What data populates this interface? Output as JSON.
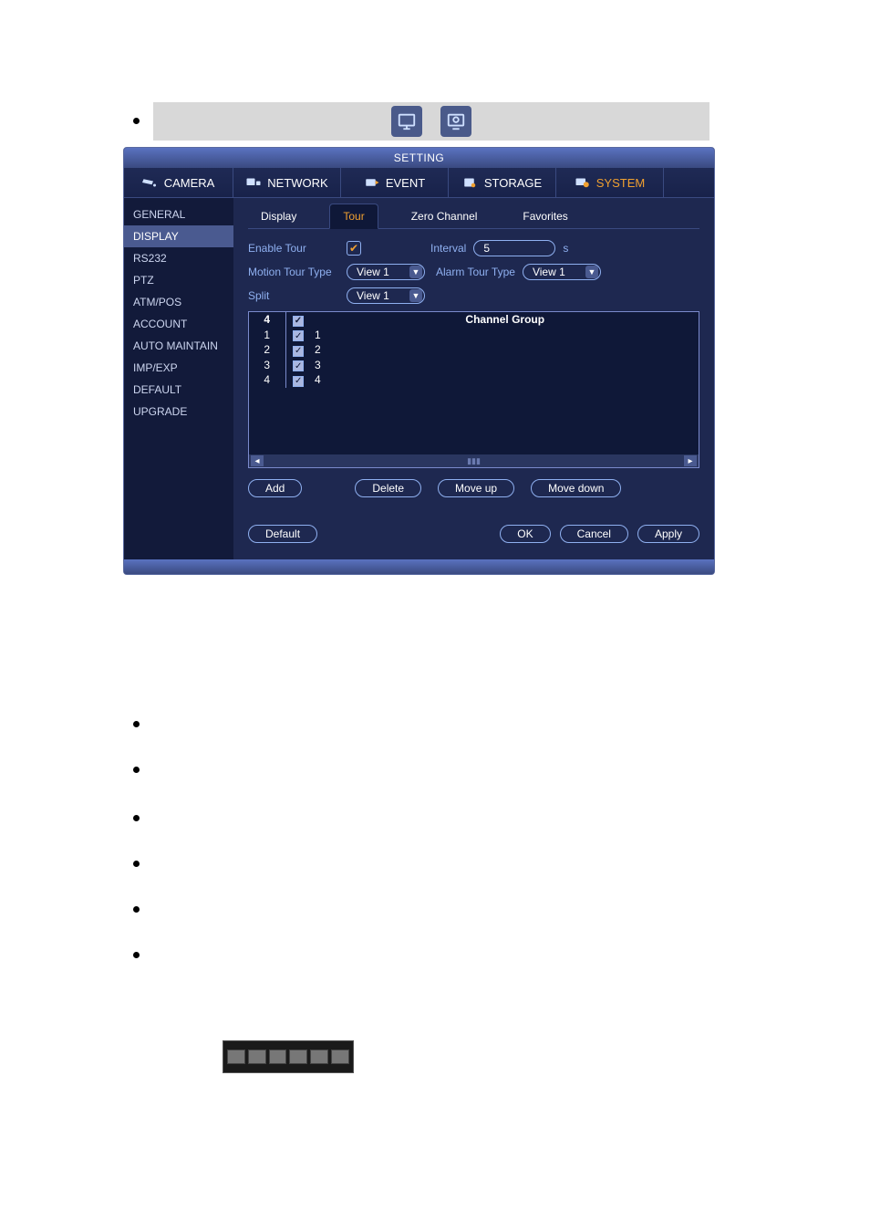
{
  "dialog_title": "SETTING",
  "toptabs": [
    {
      "label": "CAMERA"
    },
    {
      "label": "NETWORK"
    },
    {
      "label": "EVENT"
    },
    {
      "label": "STORAGE"
    },
    {
      "label": "SYSTEM"
    }
  ],
  "sidebar": [
    "GENERAL",
    "DISPLAY",
    "RS232",
    "PTZ",
    "ATM/POS",
    "ACCOUNT",
    "AUTO MAINTAIN",
    "IMP/EXP",
    "DEFAULT",
    "UPGRADE"
  ],
  "sidebar_selected": 1,
  "subtabs": [
    "Display",
    "Tour",
    "Zero Channel",
    "Favorites"
  ],
  "subtab_selected": 1,
  "form": {
    "enable_tour_label": "Enable Tour",
    "enable_tour_checked": true,
    "interval_label": "Interval",
    "interval_value": "5",
    "interval_unit": "s",
    "motion_tour_label": "Motion Tour Type",
    "motion_tour_value": "View 1",
    "alarm_tour_label": "Alarm Tour Type",
    "alarm_tour_value": "View 1",
    "split_label": "Split",
    "split_value": "View 1"
  },
  "table": {
    "count": "4",
    "header_group": "Channel Group",
    "rows": [
      {
        "idx": "1",
        "checked": true,
        "val": "1"
      },
      {
        "idx": "2",
        "checked": true,
        "val": "2"
      },
      {
        "idx": "3",
        "checked": true,
        "val": "3"
      },
      {
        "idx": "4",
        "checked": true,
        "val": "4"
      }
    ]
  },
  "buttons": {
    "add": "Add",
    "delete": "Delete",
    "moveup": "Move up",
    "movedown": "Move down",
    "default": "Default",
    "ok": "OK",
    "cancel": "Cancel",
    "apply": "Apply"
  }
}
